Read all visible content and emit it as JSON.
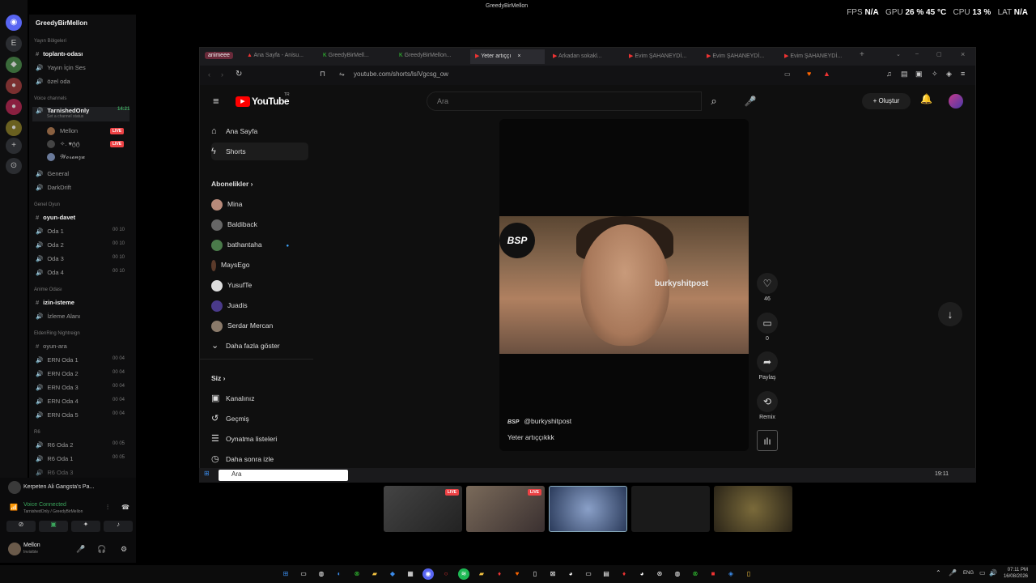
{
  "overlay": {
    "window_title": "GreedyBirMellon",
    "fps_label": "FPS",
    "fps_value": "N/A",
    "gpu_label": "GPU",
    "gpu_value": "26 % 45 °C",
    "cpu_label": "CPU",
    "cpu_value": "13 %",
    "lat_label": "LAT",
    "lat_value": "N/A"
  },
  "discord": {
    "server_name": "GreedyBirMellon",
    "categories": {
      "yayin": "Yayın Bölgeleri",
      "voice": "Voice channels",
      "genel_oyun": "Genel Oyun",
      "anime": "Anime Odası",
      "eldenring": "EldenRing Nightreign",
      "r6": "R6"
    },
    "channels": {
      "toplanti": "toplantı-odası",
      "yayin_ses": "Yayın İçin Ses",
      "ozel": "özel oda",
      "tarnished": "TarnishedOnly",
      "tarnished_time": "14:21",
      "tarnished_status": "Set a channel status",
      "member1": "Mellon",
      "member2": "✧. ♥ტტ",
      "member3": "𝓦𝓸𝓻𝓮𝓷𝔃𝓪",
      "live": "LIVE",
      "general": "General",
      "darkdrift": "DarkDrift",
      "oyun_davet": "oyun-davet",
      "oda1": "Oda 1",
      "oda2": "Oda 2",
      "oda3": "Oda 3",
      "oda4": "Oda 4",
      "cnt10": "00 10",
      "izin": "izin-isteme",
      "izleme": "İzleme Alanı",
      "oyun_ara": "oyun-ara",
      "ern1": "ERN Oda 1",
      "ern2": "ERN Oda 2",
      "ern3": "ERN Oda 3",
      "ern4": "ERN Oda 4",
      "ern5": "ERN Oda 5",
      "cnt04": "00 04",
      "r6_2": "R6 Oda 2",
      "r6_1": "R6 Oda 1",
      "r6_3": "R6 Oda 3",
      "cnt05": "00 05"
    },
    "now_playing": "Kerpeten Ali Gangsta's Pa...",
    "voice_connected": "Voice Connected",
    "voice_location": "TarnishedOnly / GreedyBirMellon",
    "user_name": "Mellon",
    "user_status": "Invisible"
  },
  "browser": {
    "tabs": [
      "animeee",
      "Ana Sayfa - Anisu...",
      "GreedyBirMell...",
      "GreedyBirMellon...",
      "Yeter artıççı",
      "Arkadan sokakl...",
      "Evim ŞAHANEYDİ...",
      "Evim ŞAHANEYDİ...",
      "Evim ŞAHANEYDİ..."
    ],
    "url": "youtube.com/shorts/lsIVgcsg_ow"
  },
  "youtube": {
    "logo": "YouTube",
    "logo_sup": "TR",
    "search_placeholder": "Ara",
    "create_label": "Oluştur",
    "nav_home": "Ana Sayfa",
    "nav_shorts": "Shorts",
    "subs_header": "Abonelikler",
    "subs": [
      "Mina",
      "Baldiback",
      "bathantaha",
      "MaysEgo",
      "YusufTe",
      "Juadis",
      "Serdar Mercan"
    ],
    "show_more": "Daha fazla göster",
    "you_header": "Siz",
    "you_items": [
      "Kanalınız",
      "Geçmiş",
      "Oynatma listeleri",
      "Daha sonra izle"
    ],
    "short_channel": "@burkyshitpost",
    "short_caption": "Yeter artıççıkkk",
    "watermark": "burkyshitpost",
    "bsp_logo": "BSP",
    "like_count": "46",
    "comment_count": "0",
    "share_label": "Paylaş",
    "remix_label": "Remix"
  },
  "taskbar_inner": {
    "search_placeholder": "Ara",
    "time": "19:11"
  },
  "stream_live": "LIVE",
  "taskbar": {
    "lang": "ENG",
    "time": "07:11 PM",
    "date": "16/08/2026"
  }
}
